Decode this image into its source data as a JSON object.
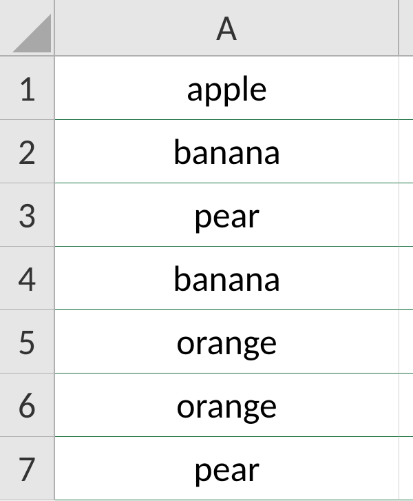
{
  "columns": [
    "A"
  ],
  "rows": [
    {
      "num": "1",
      "value": "apple"
    },
    {
      "num": "2",
      "value": "banana"
    },
    {
      "num": "3",
      "value": "pear"
    },
    {
      "num": "4",
      "value": "banana"
    },
    {
      "num": "5",
      "value": "orange"
    },
    {
      "num": "6",
      "value": "orange"
    },
    {
      "num": "7",
      "value": "pear"
    }
  ]
}
